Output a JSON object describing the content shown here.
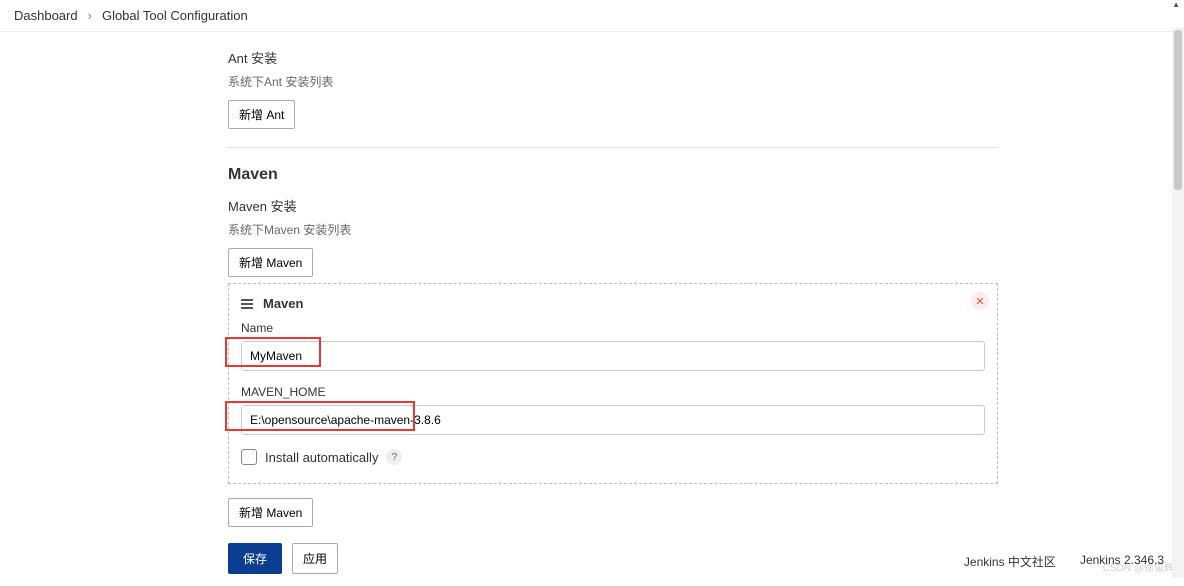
{
  "breadcrumb": {
    "home": "Dashboard",
    "current": "Global Tool Configuration"
  },
  "ant": {
    "section_label": "Ant 安装",
    "hint": "系统下Ant 安装列表",
    "add_button": "新增 Ant"
  },
  "maven": {
    "title": "Maven",
    "section_label": "Maven 安装",
    "hint": "系统下Maven 安装列表",
    "add_button_top": "新增 Maven",
    "panel": {
      "heading": "Maven",
      "name_label": "Name",
      "name_value": "MyMaven",
      "home_label": "MAVEN_HOME",
      "home_value": "E:\\opensource\\apache-maven-3.8.6",
      "auto_install": "Install automatically"
    },
    "add_button_bottom": "新增 Maven"
  },
  "actions": {
    "save": "保存",
    "apply": "应用"
  },
  "footer": {
    "community": "Jenkins 中文社区",
    "version": "Jenkins 2.346.3"
  },
  "watermark": "CSDN @徐俊辉"
}
